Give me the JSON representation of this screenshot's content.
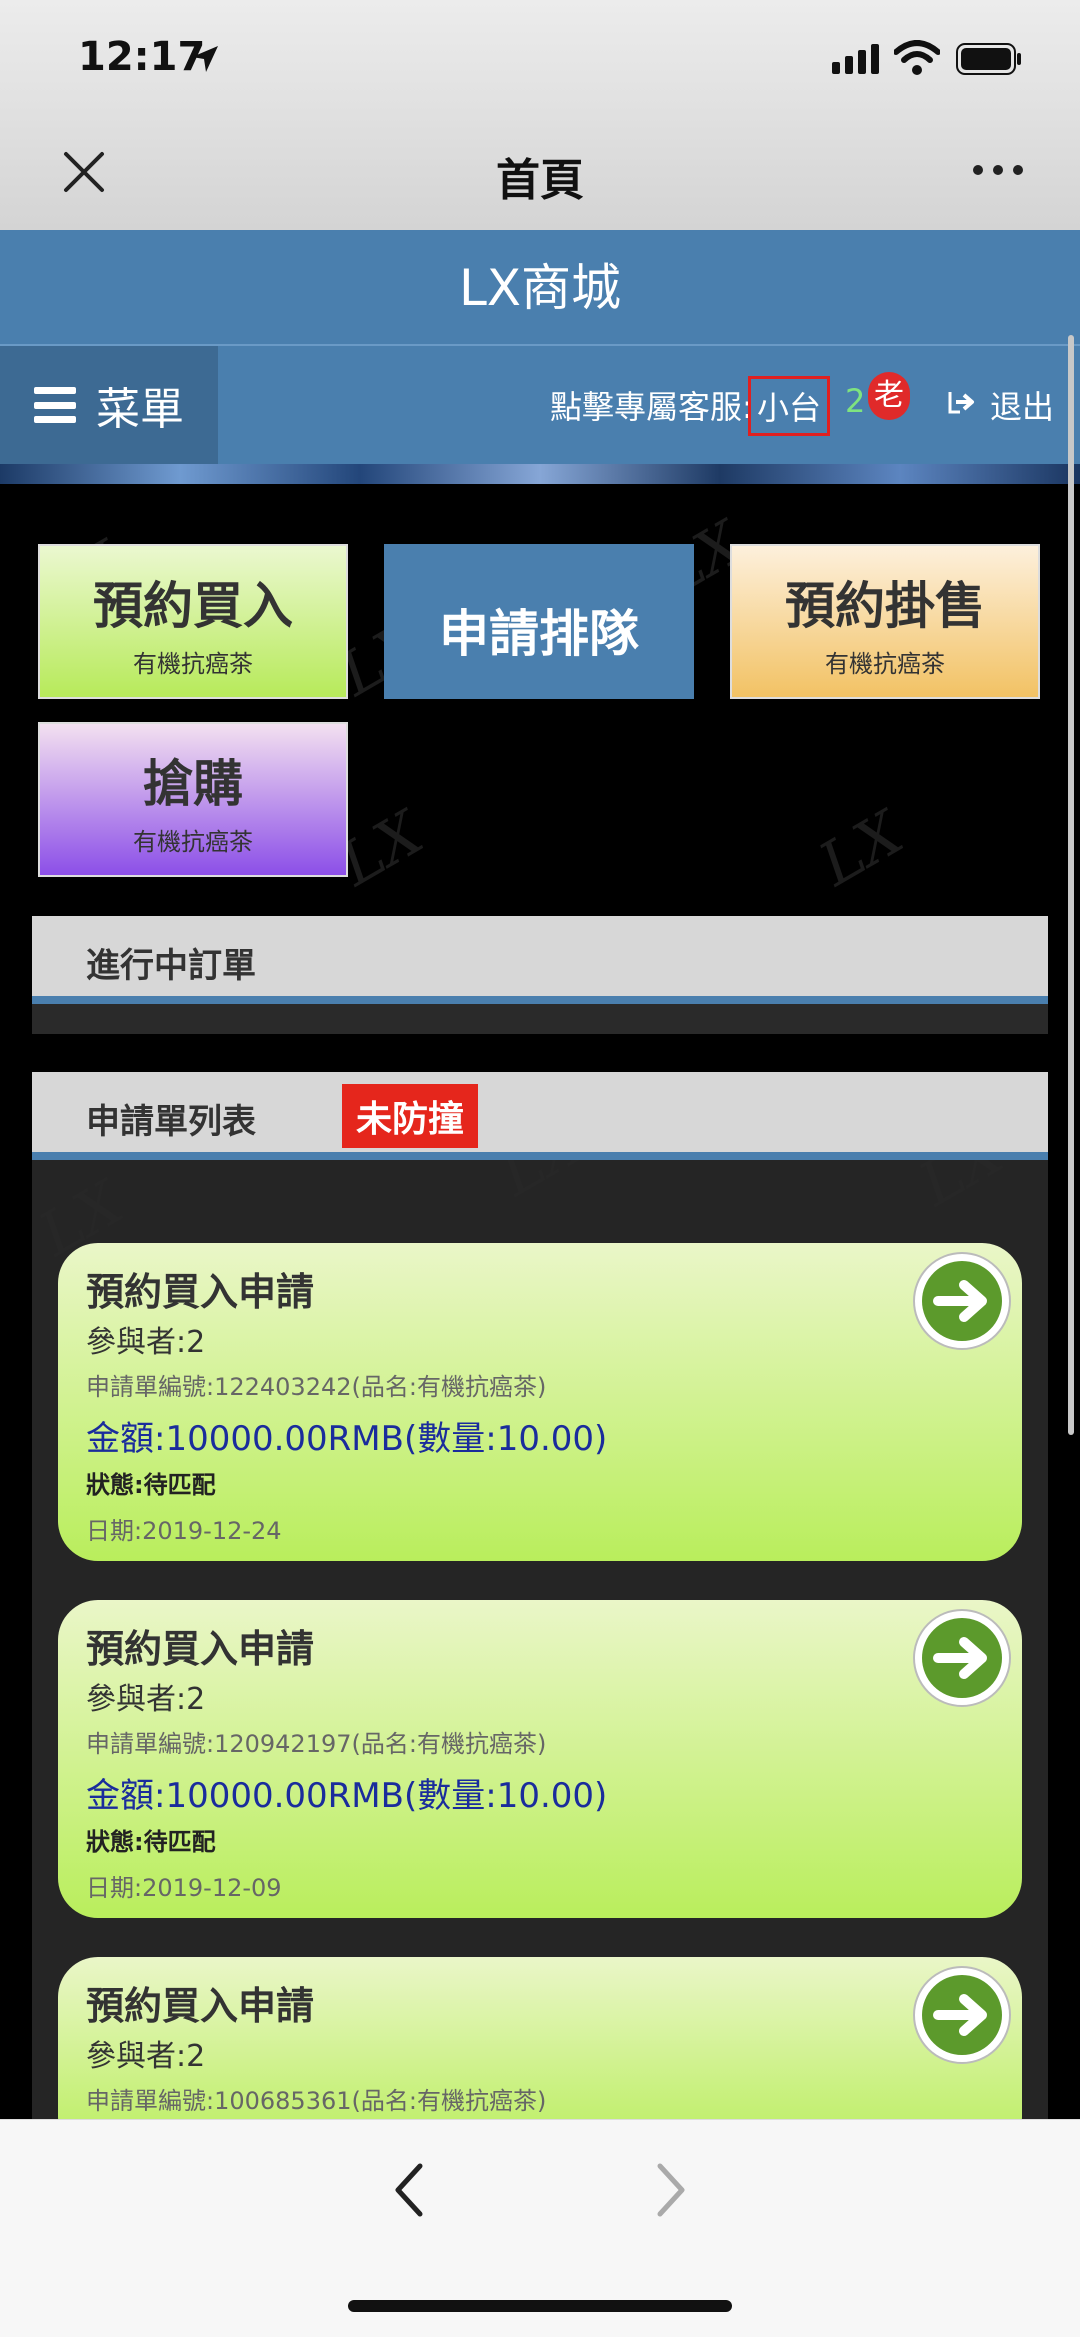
{
  "status": {
    "time": "12:17"
  },
  "nav": {
    "title": "首頁"
  },
  "site": {
    "title": "LX商城",
    "menu_label": "菜單",
    "service_label": "點擊專屬客服:",
    "service_name": "小台",
    "count": "2",
    "badge": "老",
    "logout": "退出"
  },
  "tiles": [
    {
      "title": "預約買入",
      "sub": "有機抗癌茶"
    },
    {
      "title": "申請排隊",
      "sub": ""
    },
    {
      "title": "預約掛售",
      "sub": "有機抗癌茶"
    },
    {
      "title": "搶購",
      "sub": "有機抗癌茶"
    }
  ],
  "sections": {
    "ongoing": "進行中訂單",
    "applications": "申請單列表",
    "tag": "未防撞"
  },
  "orders": [
    {
      "title": "預約買入申請",
      "participants": "參與者:2",
      "number": "申請單編號:122403242(品名:有機抗癌茶)",
      "amount": "金額:10000.00RMB(數量:10.00)",
      "status": "狀態:待匹配",
      "date": "日期:2019-12-24"
    },
    {
      "title": "預約買入申請",
      "participants": "參與者:2",
      "number": "申請單編號:120942197(品名:有機抗癌茶)",
      "amount": "金額:10000.00RMB(數量:10.00)",
      "status": "狀態:待匹配",
      "date": "日期:2019-12-09"
    },
    {
      "title": "預約買入申請",
      "participants": "參與者:2",
      "number": "申請單編號:100685361(品名:有機抗癌茶)"
    }
  ],
  "colors": {
    "header": "#4a7fae",
    "tag": "#e5261c",
    "card": "#b9ee5c",
    "amount": "#1a2c9c"
  }
}
